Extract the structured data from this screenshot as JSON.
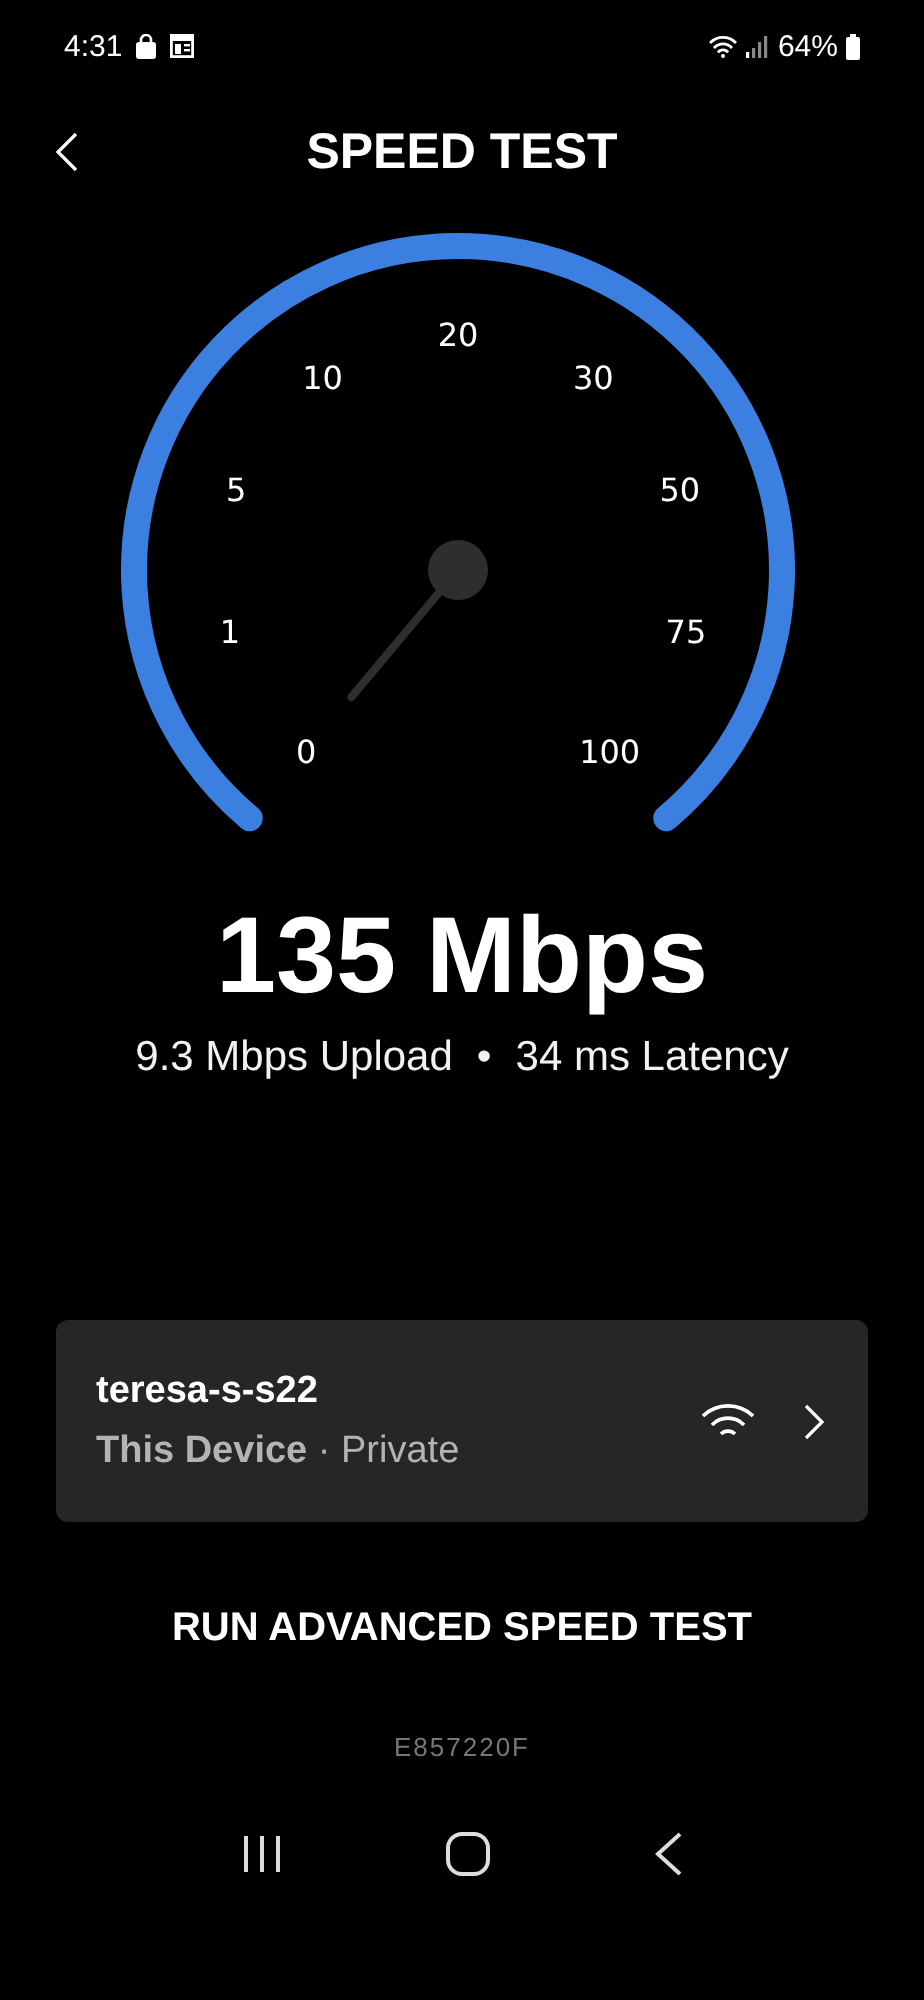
{
  "status_bar": {
    "time": "4:31",
    "battery": "64%"
  },
  "header": {
    "title": "SPEED TEST"
  },
  "gauge": {
    "labels": [
      "0",
      "1",
      "5",
      "10",
      "20",
      "30",
      "50",
      "75",
      "100"
    ]
  },
  "result": {
    "speed": "135 Mbps",
    "upload": "9.3 Mbps Upload",
    "separator": "•",
    "latency": "34 ms Latency"
  },
  "device_card": {
    "name": "teresa-s-s22",
    "label": "This Device",
    "detail": "· Private"
  },
  "advanced_button": "RUN ADVANCED SPEED TEST",
  "device_id": "E857220F"
}
